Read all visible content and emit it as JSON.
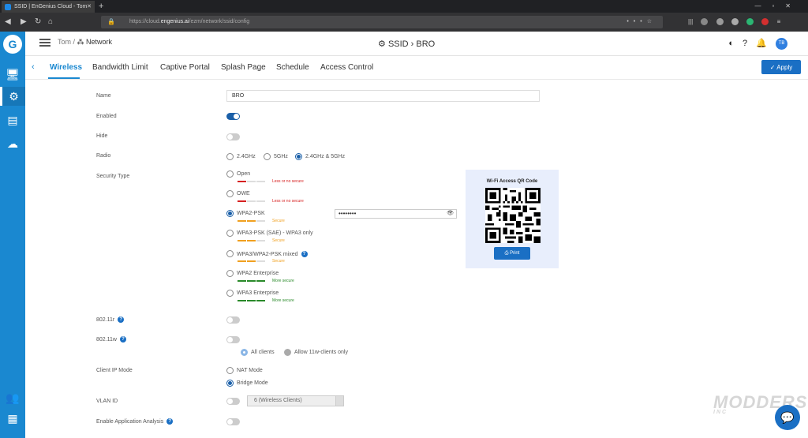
{
  "browser": {
    "tab_title": "SSID | EnGenius Cloud - Tom",
    "tab_close": "✕",
    "new_tab": "+",
    "window_controls": "—▫✕",
    "url_prefix": "https://cloud.",
    "url_host": "engenius.ai",
    "url_path": "/ezm/network/ssid/config"
  },
  "header": {
    "crumb_org": "Tom /",
    "crumb_network": "Network",
    "ssid_title": "SSID › BRO",
    "avatar": "TB"
  },
  "tabs": {
    "back": "‹",
    "items": [
      "Wireless",
      "Bandwidth Limit",
      "Captive Portal",
      "Splash Page",
      "Schedule",
      "Access Control"
    ],
    "apply": "Apply"
  },
  "form": {
    "name_label": "Name",
    "name_value": "BRO",
    "enabled_label": "Enabled",
    "hide_label": "Hide",
    "radio_label": "Radio",
    "radio_options": [
      "2.4GHz",
      "5GHz",
      "2.4GHz & 5GHz"
    ],
    "security_label": "Security Type",
    "security_options": [
      {
        "label": "Open",
        "strength": "Less or no secure"
      },
      {
        "label": "OWE",
        "strength": "Less or no secure"
      },
      {
        "label": "WPA2-PSK",
        "strength": "Secure"
      },
      {
        "label": "WPA3-PSK (SAE) - WPA3 only",
        "strength": "Secure"
      },
      {
        "label": "WPA3/WPA2-PSK mixed",
        "strength": "Secure"
      },
      {
        "label": "WPA2 Enterprise",
        "strength": "More secure"
      },
      {
        "label": "WPA3 Enterprise",
        "strength": "More secure"
      }
    ],
    "password_mask": "••••••••",
    "qr_title": "Wi-Fi Access QR Code",
    "print_label": "Print",
    "r80211r_label": "802.11r",
    "r80211w_label": "802.11w",
    "w_options": [
      "All clients",
      "Allow 11w-clients only"
    ],
    "client_ip_label": "Client IP Mode",
    "client_ip_options": [
      "NAT Mode",
      "Bridge Mode"
    ],
    "vlan_label": "VLAN ID",
    "vlan_value": "6 (Wireless Clients)",
    "app_analysis_label": "Enable Application Analysis"
  },
  "colors": {
    "brand": "#1a88d0",
    "less_secure": "#d62020",
    "secure": "#f0a020",
    "more_secure": "#2a8a2a"
  },
  "watermark": {
    "line1": "MODDERS",
    "line2": "INC"
  }
}
